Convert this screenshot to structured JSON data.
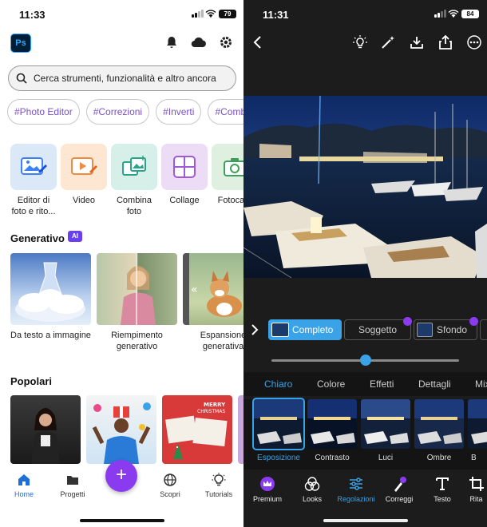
{
  "left": {
    "status": {
      "time": "11:33",
      "battery": "79"
    },
    "search": {
      "placeholder": "Cerca strumenti, funzionalità e altro ancora"
    },
    "chips": [
      "#Photo Editor",
      "#Correzioni",
      "#Inverti",
      "#Combina"
    ],
    "tools": [
      {
        "label": "Editor di foto e rito...",
        "icon": "photo-edit-icon",
        "bg": "#dbe8f8"
      },
      {
        "label": "Video",
        "icon": "video-edit-icon",
        "bg": "#fde7d3"
      },
      {
        "label": "Combina foto",
        "icon": "combine-photos-icon",
        "bg": "#d6efe8"
      },
      {
        "label": "Collage",
        "icon": "collage-icon",
        "bg": "#ecdcf6"
      },
      {
        "label": "Fotocam",
        "icon": "camera-icon",
        "bg": "#dff0e0"
      }
    ],
    "generative": {
      "title": "Generativo",
      "badge": "AI",
      "cards": [
        {
          "label": "Da testo a immagine"
        },
        {
          "label": "Riempimento generativo"
        },
        {
          "label": "Espansione generativa"
        }
      ]
    },
    "popular": {
      "title": "Popolari"
    },
    "nav": [
      {
        "label": "Home",
        "icon": "home-icon"
      },
      {
        "label": "Progetti",
        "icon": "folder-icon"
      },
      {
        "label": "Scopri",
        "icon": "globe-icon"
      },
      {
        "label": "Tutorials",
        "icon": "lightbulb-icon"
      }
    ],
    "fab": "+"
  },
  "right": {
    "status": {
      "time": "11:31",
      "battery": "84"
    },
    "masks": [
      {
        "label": "Completo"
      },
      {
        "label": "Soggetto"
      },
      {
        "label": "Sfondo"
      }
    ],
    "slider": {
      "value": 0.5
    },
    "tabs": [
      "Chiaro",
      "Colore",
      "Effetti",
      "Dettagli",
      "Mix"
    ],
    "active_tab": "Chiaro",
    "presets": [
      "Esposizione",
      "Contrasto",
      "Luci",
      "Ombre",
      "B"
    ],
    "toolbar": [
      {
        "label": "Premium",
        "icon": "crown-icon"
      },
      {
        "label": "Looks",
        "icon": "looks-icon"
      },
      {
        "label": "Regolazioni",
        "icon": "sliders-icon"
      },
      {
        "label": "Correggi",
        "icon": "brush-icon"
      },
      {
        "label": "Testo",
        "icon": "text-icon"
      },
      {
        "label": "Rita",
        "icon": "crop-icon"
      }
    ],
    "colors": {
      "accent": "#3aa2e6",
      "premium": "#8a3bf0"
    }
  }
}
